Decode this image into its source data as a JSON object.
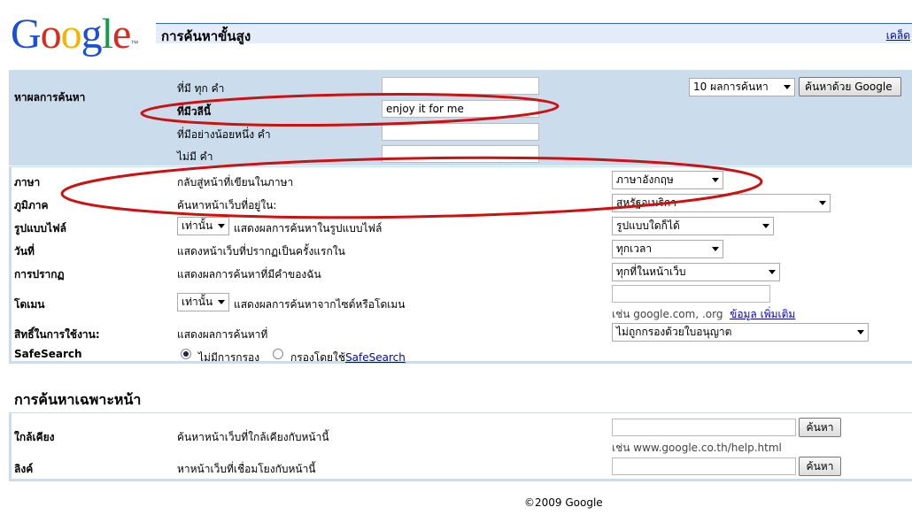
{
  "header": {
    "logo_text": "Google",
    "logo_tm": "™",
    "page_title": "การค้นหาขั้นสูง",
    "tips_link": "เคล็ด"
  },
  "find": {
    "section_label": "หาผลการค้นหา",
    "all_words_label": "ที่มี ทุก คำ",
    "phrase_label": "ที่มีวลีนี้",
    "phrase_value": "enjoy it for me",
    "any_words_label": "ที่มีอย่างน้อยหนึ่ง คำ",
    "none_words_label": "ไม่มี คำ",
    "results_select": "10 ผลการค้นหา",
    "search_button": "ค้นหาด้วย Google"
  },
  "options": {
    "language": {
      "label": "ภาษา",
      "desc": "กลับสู่หน้าที่เขียนในภาษา",
      "value": "ภาษาอังกฤษ"
    },
    "region": {
      "label": "ภูมิภาค",
      "desc": "ค้นหาหน้าเว็บที่อยู่ใน:",
      "value": "สหรัฐอเมริกา"
    },
    "file_format": {
      "label": "รูปแบบไฟล์",
      "mode": "เท่านั้น",
      "desc": "แสดงผลการค้นหาในรูปแบบไฟล์",
      "value": "รูปแบบใดก็ได้"
    },
    "date": {
      "label": "วันที่",
      "desc": "แสดงหน้าเว็บที่ปรากฏเป็นครั้งแรกใน",
      "value": "ทุกเวลา"
    },
    "occurrences": {
      "label": "การปรากฏ",
      "desc": "แสดงผลการค้นหาที่มีคำของฉัน",
      "value": "ทุกที่ในหน้าเว็บ"
    },
    "domain": {
      "label": "โดเมน",
      "mode": "เท่านั้น",
      "desc": "แสดงผลการค้นหาจากไซต์หรือโดเมน",
      "value": "",
      "example": "เช่น google.com, .org",
      "more_info": "ข้อมูล เพิ่มเติม"
    },
    "usage_rights": {
      "label": "สิทธิ์ในการใช้งาน:",
      "desc": "แสดงผลการค้นหาที่",
      "value": "ไม่ถูกกรองด้วยใบอนุญาต"
    },
    "safesearch": {
      "label": "SafeSearch",
      "off_label": "ไม่มีการกรอง",
      "on_prefix": "กรองโดยใช้",
      "on_link": "SafeSearch",
      "selected": "off"
    }
  },
  "page_specific": {
    "title": "การค้นหาเฉพาะหน้า",
    "similar": {
      "label": "ใกล้เคียง",
      "desc": "ค้นหาหน้าเว็บที่ใกล้เคียงกับหน้านี้",
      "value": "",
      "button": "ค้นหา",
      "example": "เช่น www.google.co.th/help.html"
    },
    "links": {
      "label": "ลิงค์",
      "desc": "หาหน้าเว็บที่เชื่อมโยงกับหน้านี้",
      "value": "",
      "button": "ค้นหา"
    }
  },
  "footer": {
    "copyright": "©2009 Google"
  },
  "colors": {
    "panel": "#cbdced",
    "title_bar": "#e5ecf9",
    "annotation": "#cc1111",
    "link": "#0000cc"
  }
}
